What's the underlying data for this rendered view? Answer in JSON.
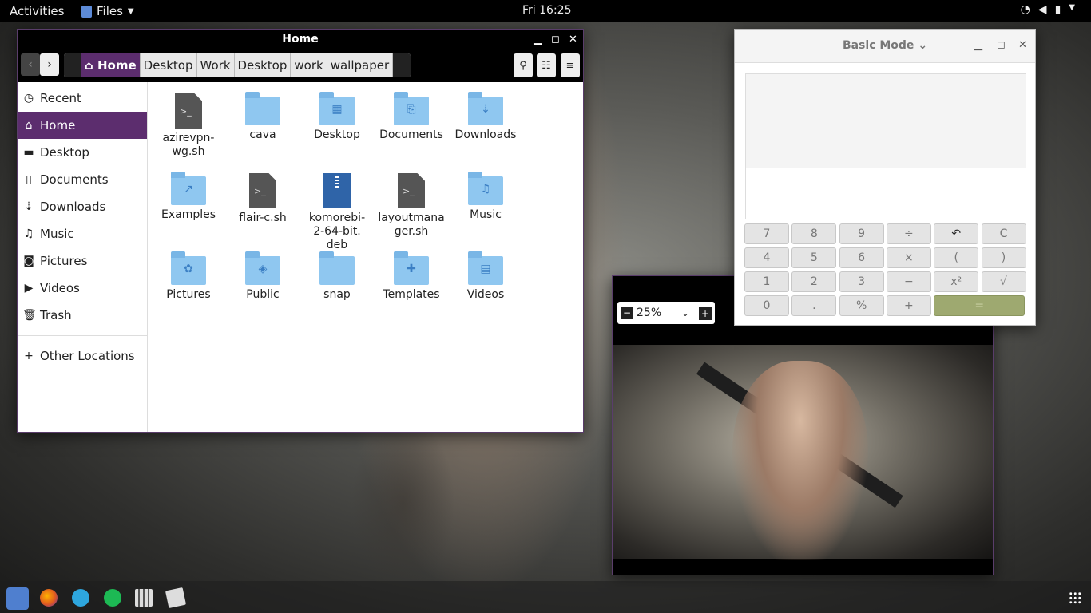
{
  "topbar": {
    "activities": "Activities",
    "app_menu": "Files",
    "clock": "Fri 16:25",
    "tray_icons": [
      "wifi-icon",
      "volume-muted-icon",
      "battery-charging-icon",
      "power-menu-icon"
    ]
  },
  "files": {
    "title": "Home",
    "breadcrumbs": [
      "Home",
      "Desktop",
      "Work",
      "Desktop",
      "work",
      "wallpaper"
    ],
    "sidebar": [
      {
        "label": "Recent",
        "icon": "recent-icon"
      },
      {
        "label": "Home",
        "icon": "home-icon"
      },
      {
        "label": "Desktop",
        "icon": "folder-icon"
      },
      {
        "label": "Documents",
        "icon": "document-icon"
      },
      {
        "label": "Downloads",
        "icon": "download-icon"
      },
      {
        "label": "Music",
        "icon": "music-icon"
      },
      {
        "label": "Pictures",
        "icon": "camera-icon"
      },
      {
        "label": "Videos",
        "icon": "video-icon"
      },
      {
        "label": "Trash",
        "icon": "trash-icon"
      }
    ],
    "other_locations": "Other Locations",
    "items": [
      {
        "l1": "azirevpn-",
        "l2": "wg.sh",
        "l3": "",
        "type": "script"
      },
      {
        "l1": "cava",
        "l2": "",
        "l3": "",
        "type": "folder"
      },
      {
        "l1": "Desktop",
        "l2": "",
        "l3": "",
        "type": "folder"
      },
      {
        "l1": "Documents",
        "l2": "",
        "l3": "",
        "type": "folder"
      },
      {
        "l1": "Downloads",
        "l2": "",
        "l3": "",
        "type": "folder"
      },
      {
        "l1": "Examples",
        "l2": "",
        "l3": "",
        "type": "folder"
      },
      {
        "l1": "flair-c.sh",
        "l2": "",
        "l3": "",
        "type": "script"
      },
      {
        "l1": "komorebi-",
        "l2": "2-64-bit.",
        "l3": "deb",
        "type": "deb"
      },
      {
        "l1": "layoutmana",
        "l2": "ger.sh",
        "l3": "",
        "type": "script"
      },
      {
        "l1": "Music",
        "l2": "",
        "l3": "",
        "type": "folder"
      },
      {
        "l1": "Pictures",
        "l2": "",
        "l3": "",
        "type": "folder"
      },
      {
        "l1": "Public",
        "l2": "",
        "l3": "",
        "type": "folder"
      },
      {
        "l1": "snap",
        "l2": "",
        "l3": "",
        "type": "folder"
      },
      {
        "l1": "Templates",
        "l2": "",
        "l3": "",
        "type": "folder"
      },
      {
        "l1": "Videos",
        "l2": "",
        "l3": "",
        "type": "folder"
      }
    ]
  },
  "viewer": {
    "zoom": "25%"
  },
  "calculator": {
    "mode": "Basic Mode",
    "keys": [
      [
        "7",
        "8",
        "9",
        "÷",
        "↶",
        "C"
      ],
      [
        "4",
        "5",
        "6",
        "×",
        "(",
        ")"
      ],
      [
        "1",
        "2",
        "3",
        "−",
        "x²",
        "√"
      ],
      [
        "0",
        ".",
        "%",
        "+",
        "="
      ]
    ]
  },
  "dock": [
    "files-icon",
    "firefox-icon",
    "telegram-icon",
    "spotify-icon",
    "calculator-icon",
    "image-viewer-icon",
    "show-apps-icon"
  ]
}
